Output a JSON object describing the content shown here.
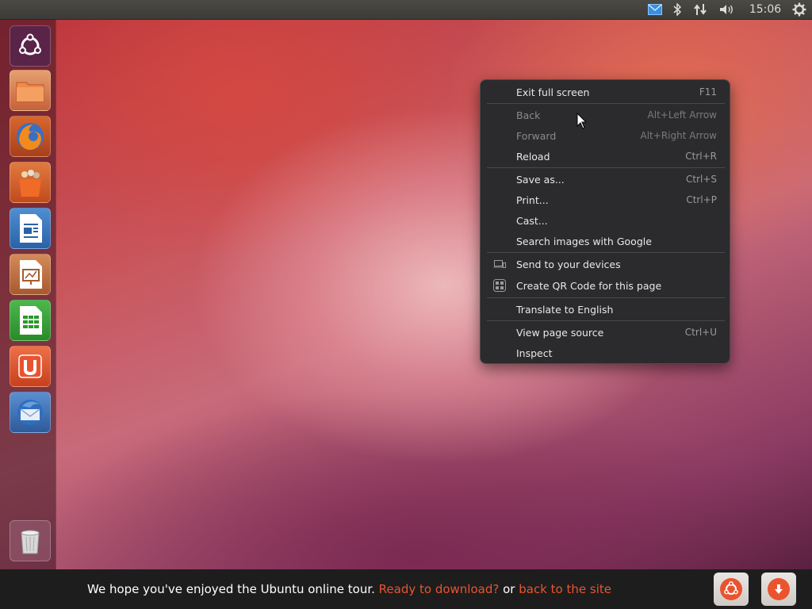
{
  "top_panel": {
    "clock": "15:06",
    "indicators": [
      "mail-icon",
      "bluetooth-icon",
      "network-icon",
      "volume-icon",
      "gear-icon"
    ]
  },
  "launcher": {
    "items": [
      {
        "name": "dash-home",
        "icon": "ubuntu-logo-icon"
      },
      {
        "name": "files",
        "icon": "folder-icon"
      },
      {
        "name": "firefox",
        "icon": "firefox-icon"
      },
      {
        "name": "software-center",
        "icon": "shopping-bag-icon"
      },
      {
        "name": "libreoffice-writer",
        "icon": "writer-icon"
      },
      {
        "name": "libreoffice-impress",
        "icon": "impress-icon"
      },
      {
        "name": "libreoffice-calc",
        "icon": "calc-icon"
      },
      {
        "name": "ubuntu-one",
        "icon": "ubuntu-one-icon"
      },
      {
        "name": "thunderbird",
        "icon": "thunderbird-icon"
      },
      {
        "name": "trash",
        "icon": "trash-icon"
      }
    ]
  },
  "context_menu": {
    "items": [
      {
        "label": "Exit full screen",
        "shortcut": "F11"
      },
      {
        "label": "Back",
        "shortcut": "Alt+Left Arrow",
        "disabled": true
      },
      {
        "label": "Forward",
        "shortcut": "Alt+Right Arrow",
        "disabled": true
      },
      {
        "label": "Reload",
        "shortcut": "Ctrl+R"
      },
      {
        "label": "Save as...",
        "shortcut": "Ctrl+S"
      },
      {
        "label": "Print...",
        "shortcut": "Ctrl+P"
      },
      {
        "label": "Cast...",
        "shortcut": ""
      },
      {
        "label": "Search images with Google",
        "shortcut": ""
      },
      {
        "label": "Send to your devices",
        "shortcut": "",
        "icon": "devices-icon"
      },
      {
        "label": "Create QR Code for this page",
        "shortcut": "",
        "icon": "qr-code-icon"
      },
      {
        "label": "Translate to English",
        "shortcut": ""
      },
      {
        "label": "View page source",
        "shortcut": "Ctrl+U"
      },
      {
        "label": "Inspect",
        "shortcut": ""
      }
    ]
  },
  "bottom_bar": {
    "text": "We hope you've enjoyed the Ubuntu online tour.",
    "download_link": "Ready to download?",
    "or_text": "or",
    "back_link": "back to the site"
  },
  "colors": {
    "accent": "#e9542f",
    "panel": "#3c3b37",
    "menu_bg": "#2b2b2d"
  }
}
